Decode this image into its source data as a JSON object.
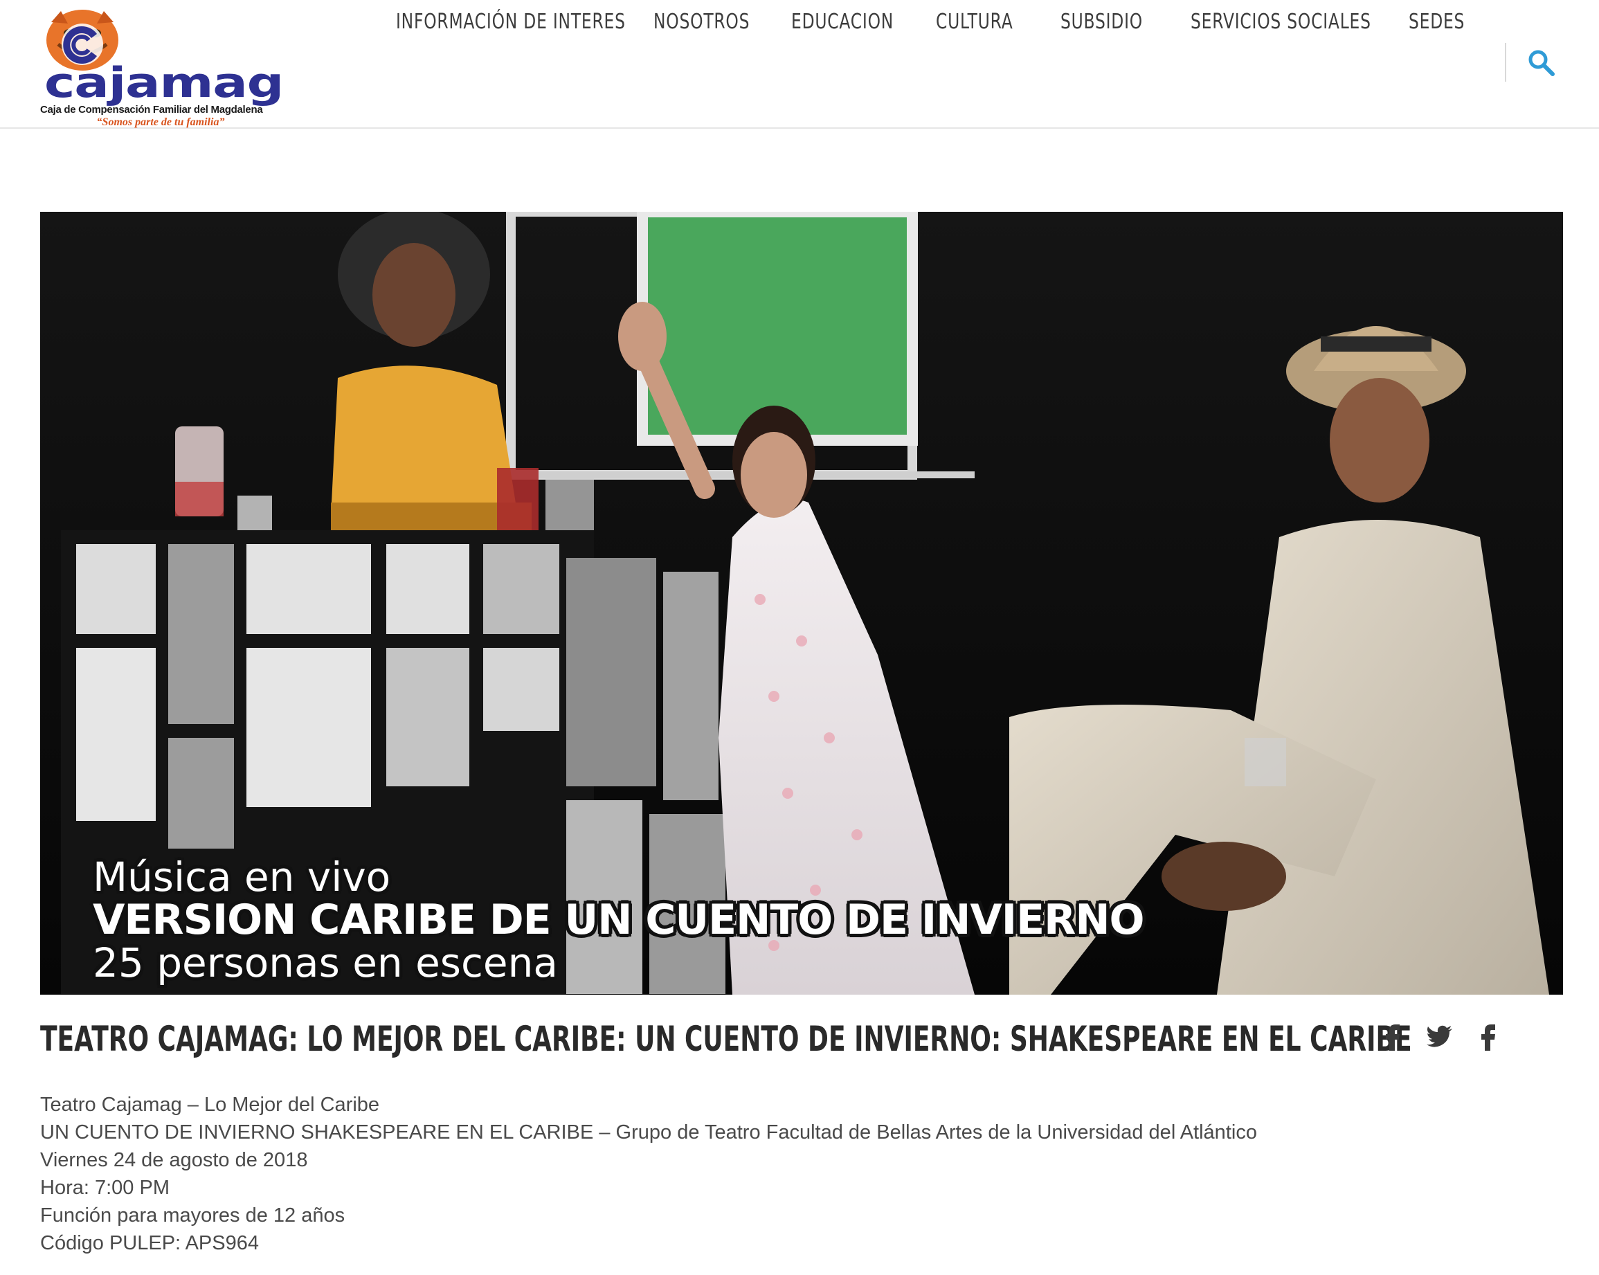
{
  "brand": {
    "name": "cajamag",
    "subtitle": "Caja de Compensación Familiar del Magdalena",
    "tagline": "“Somos parte de tu familia”",
    "colors": {
      "primary": "#2e3192",
      "accent": "#d9541e"
    }
  },
  "nav": {
    "items": [
      {
        "label": "Información de interes"
      },
      {
        "label": "Nosotros"
      },
      {
        "label": "Educacion"
      },
      {
        "label": "Cultura"
      },
      {
        "label": "Subsidio"
      },
      {
        "label": "Servicios sociales"
      },
      {
        "label": "Sedes"
      }
    ],
    "search_icon": "search-icon"
  },
  "hero": {
    "overlay_lines": [
      "Música en vivo",
      "VERSION CARIBE DE UN CUENTO DE INVIERNO",
      "25 personas en escena"
    ]
  },
  "post": {
    "title": "Teatro Cajamag: Lo Mejor del Caribe: Un Cuento de Invierno: Shakespeare en el Caribe",
    "share_icons": [
      "facebook-icon",
      "twitter-icon",
      "facebook-icon"
    ],
    "body": [
      "Teatro Cajamag – Lo Mejor del Caribe",
      "UN CUENTO DE INVIERNO SHAKESPEARE EN EL CARIBE – Grupo de Teatro Facultad de Bellas Artes de la Universidad del Atlántico",
      "Viernes 24 de agosto de 2018",
      "Hora: 7:00 PM",
      "Función para mayores de 12 años",
      "Código PULEP: APS964"
    ]
  }
}
